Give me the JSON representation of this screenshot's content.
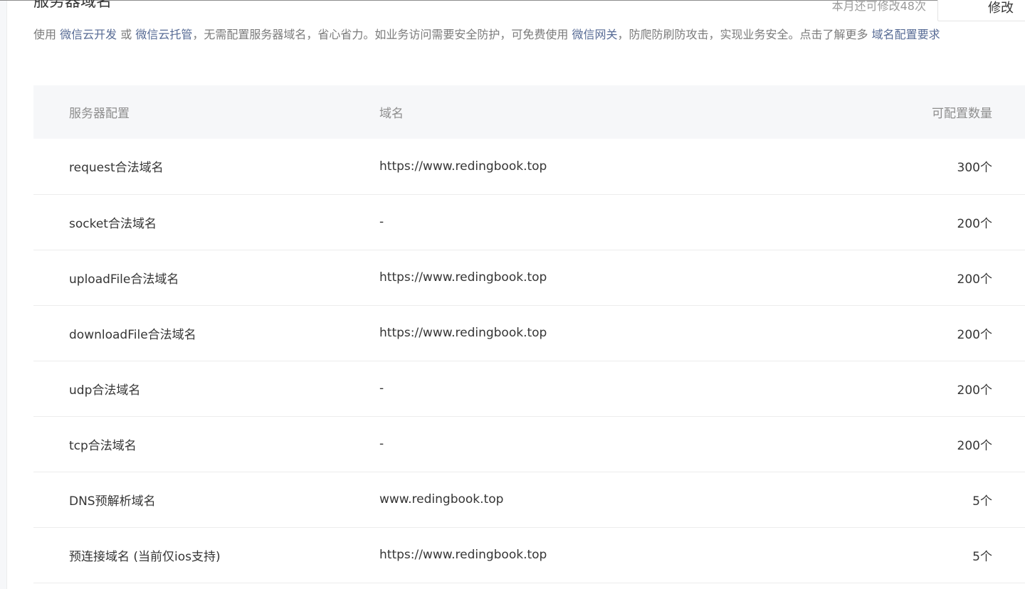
{
  "section": {
    "title": "服务器域名",
    "quota_note": "本月还可修改48次",
    "modify_label": "修改"
  },
  "description": {
    "prefix": "使用",
    "link_cloud_dev": "微信云开发",
    "or": "或",
    "link_cloud_host": "微信云托管",
    "middle": "，无需配置服务器域名，省心省力。如业务访问需要安全防护，可免费使用",
    "link_gateway": "微信网关",
    "suffix": "，防爬防刷防攻击，实现业务安全。点击了解更多",
    "link_requirements": "域名配置要求"
  },
  "table": {
    "headers": {
      "config": "服务器配置",
      "domain": "域名",
      "count": "可配置数量"
    },
    "rows": [
      {
        "config": "request合法域名",
        "domain": "https://www.redingbook.top",
        "count": "300个"
      },
      {
        "config": "socket合法域名",
        "domain": "-",
        "count": "200个"
      },
      {
        "config": "uploadFile合法域名",
        "domain": "https://www.redingbook.top",
        "count": "200个"
      },
      {
        "config": "downloadFile合法域名",
        "domain": "https://www.redingbook.top",
        "count": "200个"
      },
      {
        "config": "udp合法域名",
        "domain": "-",
        "count": "200个"
      },
      {
        "config": "tcp合法域名",
        "domain": "-",
        "count": "200个"
      },
      {
        "config": "DNS预解析域名",
        "domain": "www.redingbook.top",
        "count": "5个"
      },
      {
        "config": "预连接域名 (当前仅ios支持)",
        "domain": "https://www.redingbook.top",
        "count": "5个"
      }
    ]
  },
  "colors": {
    "link": "#576b95",
    "header_bg": "#f6f7f9",
    "muted_text": "#7b7b7b",
    "body_text": "#353535"
  }
}
